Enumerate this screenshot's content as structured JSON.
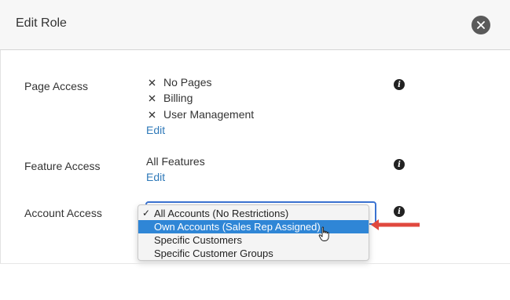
{
  "dialog": {
    "title": "Edit Role",
    "close_icon": "close-icon"
  },
  "page_access": {
    "label": "Page Access",
    "items": [
      "No Pages",
      "Billing",
      "User Management"
    ],
    "edit_label": "Edit"
  },
  "feature_access": {
    "label": "Feature Access",
    "value": "All Features",
    "edit_label": "Edit"
  },
  "account_access": {
    "label": "Account Access",
    "options": [
      "All Accounts (No Restrictions)",
      "Own Accounts (Sales Rep Assigned)",
      "Specific Customers",
      "Specific Customer Groups"
    ],
    "checked_option": "All Accounts (No Restrictions)",
    "highlighted_option": "Own Accounts (Sales Rep Assigned)"
  },
  "info_icon_glyph": "i",
  "colors": {
    "header_bg": "#f7f7f7",
    "link": "#2f79b9",
    "highlight": "#2f86d6",
    "focus_border": "#3b73d1",
    "arrow": "#e0483e"
  }
}
